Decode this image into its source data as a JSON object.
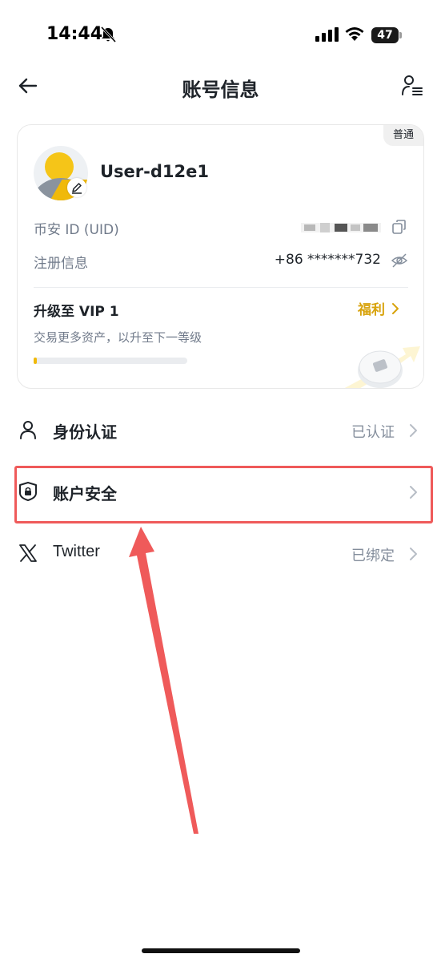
{
  "status_bar": {
    "time": "14:44",
    "battery": "47"
  },
  "header": {
    "title": "账号信息"
  },
  "profile": {
    "tier_badge": "普通",
    "username": "User-d12e1",
    "uid_label": "币安 ID (UID)",
    "registration_label": "注册信息",
    "registration_value": "+86 *******732",
    "vip": {
      "title": "升级至 VIP 1",
      "subtitle": "交易更多资产，以升至下一等级",
      "perks_label": "福利",
      "progress": 0.02
    }
  },
  "menu": [
    {
      "label": "身份认证",
      "status": "已认证",
      "icon": "person-icon"
    },
    {
      "label": "账户安全",
      "status": "",
      "icon": "shield-lock-icon"
    },
    {
      "label": "Twitter",
      "status": "已绑定",
      "icon": "x-logo-icon"
    }
  ],
  "colors": {
    "accent": "#f0b90b",
    "perks_text": "#d8a30c",
    "highlight": "#ef5a5a",
    "muted_text": "#707a8a"
  }
}
